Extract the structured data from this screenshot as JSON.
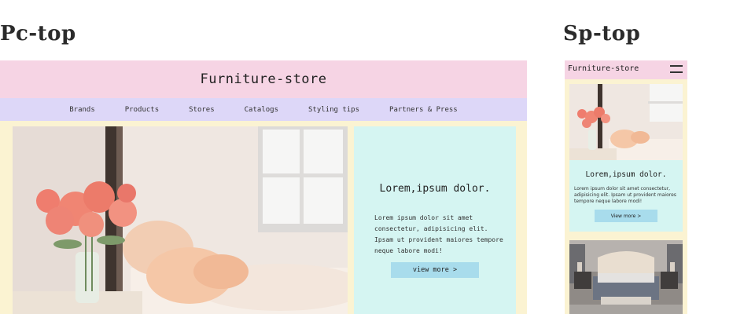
{
  "labels": {
    "pc": "Pc-top",
    "sp": "Sp-top"
  },
  "pc": {
    "logo": "Furniture-store",
    "nav": [
      "Brands",
      "Products",
      "Stores",
      "Catalogs",
      "Styling tips",
      "Partners & Press"
    ],
    "card": {
      "heading": "Lorem,ipsum dolor.",
      "body": "Lorem ipsum dolor sit amet consectetur, adipisicing elit. Ipsam ut provident maiores tempore neque labore modi!",
      "button": "view more  >"
    }
  },
  "sp": {
    "logo": "Furniture-store",
    "menu_icon": "hamburger-icon",
    "card": {
      "heading": "Lorem,ipsum dolor.",
      "body": "Lorem ipsum dolor sit amet consectetur, adipisicing elit. Ipsam ut provident maiores tempore neque labore modi!",
      "button": "View more  >"
    }
  },
  "colors": {
    "header": "#f6d4e4",
    "nav": "#ddd7f8",
    "page_bg": "#fbf3d2",
    "card_bg": "#d5f5f2",
    "button_bg": "#a8dcec"
  }
}
